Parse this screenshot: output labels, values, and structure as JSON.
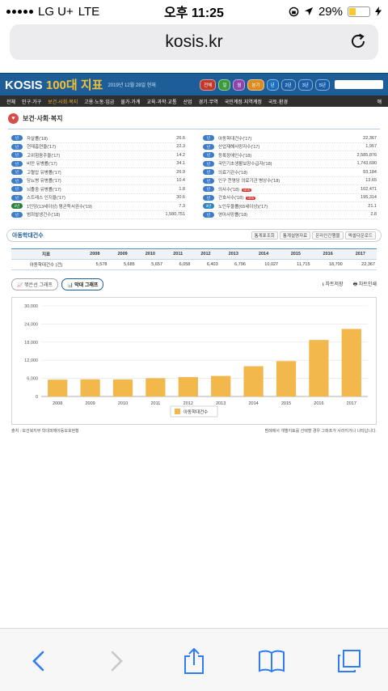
{
  "status": {
    "carrier": "LG U+",
    "network": "LTE",
    "time": "오후 11:25",
    "battery": "29%",
    "battery_level": 0.29
  },
  "browser": {
    "domain": "kosis.kr"
  },
  "kosis": {
    "logo_prefix": "KOSIS",
    "logo_suffix": "100대 지표",
    "date": "2019년 12월 28일 현재",
    "buttons": [
      "전체",
      "일",
      "월",
      "분기",
      "년",
      "2년",
      "3년",
      "5년"
    ],
    "nav": [
      "전체",
      "인구·가구",
      "보건·사회·복지",
      "고용·노동·임금",
      "물가·가계",
      "교육·과학·교통",
      "산업",
      "경기·무역",
      "국민계정·지역계정",
      "국토·환경"
    ],
    "nav_active": 2,
    "nav_right": "얘"
  },
  "section": {
    "title": "보건·사회·복지"
  },
  "indicators_left": [
    {
      "tag": "년",
      "name": "자살률('18)",
      "value": "26.6"
    },
    {
      "tag": "년",
      "name": "현재흡연율('17)",
      "value": "22.3"
    },
    {
      "tag": "년",
      "name": "고위험음주율('17)",
      "value": "14.2"
    },
    {
      "tag": "년",
      "name": "비만 유병률('17)",
      "value": "34.1"
    },
    {
      "tag": "년",
      "name": "고혈압 유병률('17)",
      "value": "26.9"
    },
    {
      "tag": "년",
      "name": "당뇨병 유병률('17)",
      "value": "10.4"
    },
    {
      "tag": "년",
      "name": "뇌졸중 유병률('17)",
      "value": "1.8"
    },
    {
      "tag": "년",
      "name": "스트레스 인지율('17)",
      "value": "30.6"
    },
    {
      "tag": "2년",
      "name": "1인당(13세이상) 평균독서권수('19)",
      "value": "7.3"
    },
    {
      "tag": "년",
      "name": "범죄발생건수('18)",
      "value": "1,580,751"
    }
  ],
  "indicators_right": [
    {
      "tag": "년",
      "name": "아동학대건수('17)",
      "value": "22,367",
      "new": ""
    },
    {
      "tag": "년",
      "name": "산업재해사망자수('17)",
      "value": "1,957",
      "new": ""
    },
    {
      "tag": "년",
      "name": "등록장애인수('18)",
      "value": "2,585,876",
      "new": ""
    },
    {
      "tag": "년",
      "name": "국민기초생활보장수급자('18)",
      "value": "1,743,690",
      "new": ""
    },
    {
      "tag": "년",
      "name": "의료기관수('18)",
      "value": "93,184",
      "new": ""
    },
    {
      "tag": "년",
      "name": "인구 천명당 의료기관 병상수('18)",
      "value": "13.65",
      "new": ""
    },
    {
      "tag": "년",
      "name": "의사수('18)",
      "value": "102,471",
      "new": "NEW"
    },
    {
      "tag": "년",
      "name": "간호사수('18)",
      "value": "195,314",
      "new": "NEW"
    },
    {
      "tag": "3년",
      "name": "노인우울률(65세이상)('17)",
      "value": "21.1",
      "new": ""
    },
    {
      "tag": "년",
      "name": "영아사망률('18)",
      "value": "2.8",
      "new": ""
    }
  ],
  "detail": {
    "title": "아동학대건수",
    "links": [
      "통계표조회",
      "통계설명자료",
      "온라인간행물",
      "엑셀다운로드"
    ],
    "table_header_label": "지표",
    "row_label": "아동학대건수 (건)",
    "years": [
      "2008",
      "2009",
      "2010",
      "2011",
      "2012",
      "2013",
      "2014",
      "2015",
      "2016",
      "2017"
    ],
    "values": [
      "5,578",
      "5,685",
      "5,657",
      "6,058",
      "6,403",
      "6,796",
      "10,027",
      "11,715",
      "18,700",
      "22,367"
    ]
  },
  "graph_tools": {
    "line_btn": "꺾은선 그래프",
    "bar_btn": "막대 그래프",
    "save": "차트저장",
    "print": "차트인쇄"
  },
  "chart_data": {
    "type": "bar",
    "categories": [
      "2008",
      "2009",
      "2010",
      "2011",
      "2012",
      "2013",
      "2014",
      "2015",
      "2016",
      "2017"
    ],
    "values": [
      5578,
      5685,
      5657,
      6058,
      6403,
      6796,
      10027,
      11715,
      18700,
      22367
    ],
    "series": [
      {
        "name": "아동학대건수",
        "values": [
          5578,
          5685,
          5657,
          6058,
          6403,
          6796,
          10027,
          11715,
          18700,
          22367
        ]
      }
    ],
    "yticks": [
      "0",
      "6,000",
      "12,000",
      "18,000",
      "24,000",
      "30,000"
    ],
    "ylim": [
      0,
      30000
    ],
    "grid": true,
    "legend": "bottom-center",
    "bar_color": "#f2b84b"
  },
  "source_note": "출처 : 보건복지부 학대피해아동보호현황",
  "legend_note": "범례에서 개별지표를 선택할 경우 그래프가 사라지거나 나타납니다."
}
